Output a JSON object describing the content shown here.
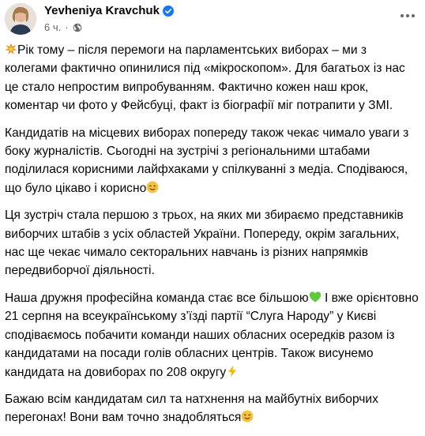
{
  "post": {
    "author": "Yevheniya Kravchuk",
    "time": "6 ч.",
    "separator": "·",
    "paragraphs": [
      {
        "lead_icon": "sparkle-burst-icon",
        "text": "Рік тому – після перемоги на парламентських виборах – ми з колегами фактично опинилися під «мікроскопом». Для багатьох із нас це стало непростим випробуванням. Фактично кожен наш крок, коментар чи фото у Фейсбуці, факт із біографії міг потрапити у ЗМІ.",
        "trail_icon": ""
      },
      {
        "lead_icon": "",
        "text": "Кандидатів на місцевих виборах попереду також чекає чимало уваги з боку журналістів. Сьогодні на зустрічі з регіональними штабами поділилася корисними лайфхаками у спілкуванні з медіа. Сподіваюся, що було цікаво і корисно",
        "trail_icon": "smiling-face-icon"
      },
      {
        "lead_icon": "",
        "text": "Ця зустріч стала першою з трьох, на яких ми збираємо представників виборчих штабів з усіх областей України. Попереду, окрім загальних, нас ще чекає чимало секторальних навчань із різних напрямків передвиборчої діяльності.",
        "trail_icon": ""
      },
      {
        "lead_icon": "",
        "text_a": "Наша дружня професійна команда стає все більшою",
        "mid_icon": "green-heart-icon",
        "text_b": " І вже орієнтовно 21 серпня на всеукраїнському з’їзді партії “Слуга Народу” у Києві сподіваємось побачити команди наших обласних осередків разом із кандидатами на посади голів обласних центрів. Також висунемо кандидата на довиборах по 208 округу",
        "trail_icon": "lightning-icon"
      },
      {
        "lead_icon": "",
        "text": "Бажаю всім кандидатам сил та натхнення на майбутніх виборчих перегонах! Вони вам точно знадобляться",
        "trail_icon": "smiling-face-icon"
      }
    ]
  },
  "colors": {
    "text": "#050505",
    "meta": "#65676b",
    "verified": "#1877f2",
    "heart": "#5fcb3c",
    "lightning": "#f7b500",
    "emoji_face": "#f7c33b"
  }
}
